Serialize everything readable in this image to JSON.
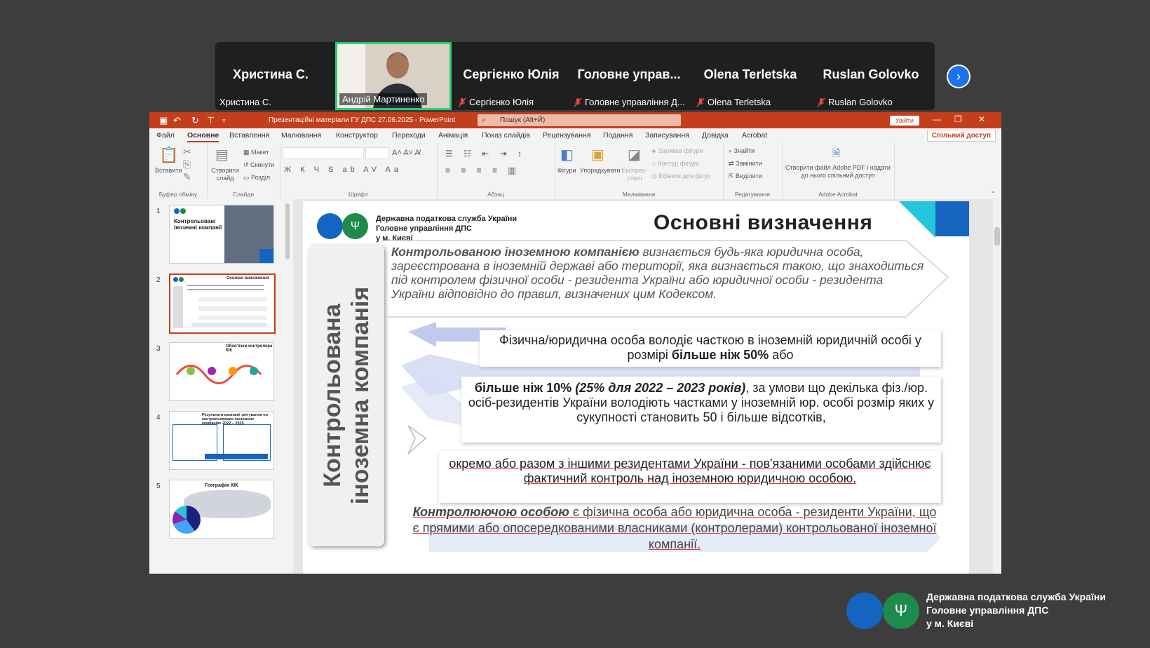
{
  "meeting": {
    "participants": [
      {
        "display": "Христина С.",
        "name": "Христина С.",
        "muted": false
      },
      {
        "display": "",
        "name": "Андрій Мартиненко",
        "muted": false,
        "video": true
      },
      {
        "display": "Сергієнко Юлія",
        "name": "Сергієнко Юлія",
        "muted": true
      },
      {
        "display": "Головне управ...",
        "name": "Головне управління Д...",
        "muted": true
      },
      {
        "display": "Olena Terletska",
        "name": "Olena Terletska",
        "muted": true
      },
      {
        "display": "Ruslan Golovko",
        "name": "Ruslan Golovko",
        "muted": true
      }
    ],
    "next_icon": "chevron-right-icon"
  },
  "ppt": {
    "doc_title": "Презентаційні матеріали ГУ ДПС 27.06.2025 - PowerPoint",
    "search_placeholder": "Пошук (Alt+Й)",
    "signin": "Увійти",
    "share": "Спільний доступ",
    "menu": [
      "Файл",
      "Основне",
      "Вставлення",
      "Малювання",
      "Конструктор",
      "Переходи",
      "Анімація",
      "Показ слайдів",
      "Рецензування",
      "Подання",
      "Записування",
      "Довідка",
      "Acrobat"
    ],
    "ribbon": {
      "paste": "Вставити",
      "clipboard": "Буфер обміну",
      "new_slide": "Створити слайд",
      "layout": "Макет",
      "reset": "Скинути",
      "section": "Розділ",
      "slides": "Слайди",
      "font": "Шрифт",
      "paragraph": "Абзац",
      "shapes": "Фігури",
      "arrange": "Упорядкувати",
      "quick_styles": "Експрес-стилі",
      "fill": "Заливка фігури",
      "outline": "Контур фігури",
      "effects": "Ефекти для фігур",
      "drawing": "Малювання",
      "find": "Знайти",
      "replace": "Замінити",
      "select": "Виділити",
      "editing": "Редагування",
      "acrobat_btn": "Створити файл Adobe PDF і надати до нього спільний доступ",
      "acrobat": "Adobe Acrobat"
    },
    "thumbnails": [
      {
        "num": "1",
        "title": "Контрольовані іноземні компанії"
      },
      {
        "num": "2",
        "title": "Основні визначення"
      },
      {
        "num": "3",
        "title": "Обов'язки контролера КІК"
      },
      {
        "num": "4",
        "title": "Результати кампанії звітування по контрольованих іноземних компаніях 2022 – 2025"
      },
      {
        "num": "5",
        "title": "Географія КІК"
      }
    ],
    "selected_thumbnail": "2"
  },
  "slide": {
    "org_line1": "Державна податкова служба України",
    "org_line2": "Головне управління ДПС",
    "org_line3": "у м. Києві",
    "title": "Основні визначення",
    "vertical_line1": "Контрольована",
    "vertical_line2": "іноземна компанія",
    "definition_bold": "Контрольованою іноземною компанією",
    "definition_rest": " визнається будь-яка юридична особа, зареєстрована в іноземній державі або території, яка визнається такою, що знаходиться під контролем фізичної особи - резидента України або юридичної особи - резидента України відповідно до правил, визначених цим Кодексом.",
    "cond1_a": "Фізична/юридична особа володіє часткою в іноземній юридичній особі у розмірі ",
    "cond1_b": "більше ніж 50%",
    "cond1_c": " або",
    "cond2_a": "більше ніж 10% ",
    "cond2_b": "(25% для 2022 – 2023 років)",
    "cond2_c": ", за умови що декілька фіз./юр. осіб-резидентів  України володіють частками у іноземній юр. особі розмір яких у сукупності становить 50 і більше відсотків,",
    "cond3": "окремо або разом з іншими резидентами України - пов'язаними особами здійснює фактичний контроль над іноземною юридичною особою.",
    "controller_bold": "Контролюючою особою",
    "controller_rest": " є фізична особа або юридична особа - резиденти України, що є прямими або опосередкованими власниками (контролерами) контрольованої іноземної компанії."
  },
  "footer": {
    "org_line1": "Державна податкова служба України",
    "org_line2": "Головне управління ДПС",
    "org_line3": "у м. Києві"
  },
  "colors": {
    "ppt_accent": "#c43e1c",
    "logo_blue": "#1565c0",
    "logo_green": "#1e8a4c",
    "active_speaker": "#2ecc71"
  }
}
